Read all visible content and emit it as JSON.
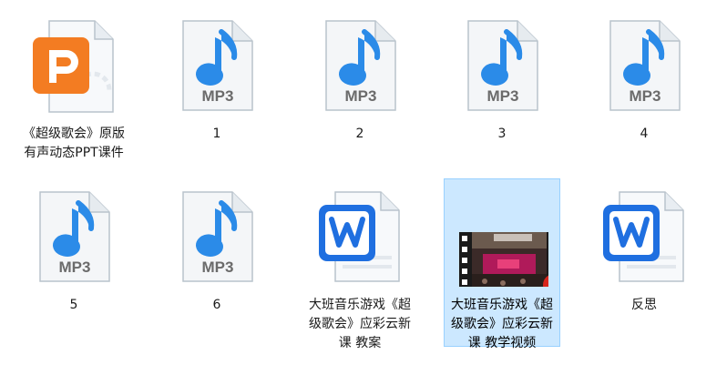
{
  "window": {
    "title": ""
  },
  "colors": {
    "accent": "#2b8be8",
    "ppt": "#f37c22",
    "wps": "#1f6fe0",
    "selection_bg": "#cce8ff",
    "selection_border": "#99d1ff"
  },
  "files": [
    {
      "name": "《超级歌会》原版有声动态PPT课件",
      "type": "ppt",
      "icon": "ppt-icon",
      "selected": false
    },
    {
      "name": "1",
      "type": "mp3",
      "icon": "mp3-icon",
      "badge": "MP3",
      "selected": false
    },
    {
      "name": "2",
      "type": "mp3",
      "icon": "mp3-icon",
      "badge": "MP3",
      "selected": false
    },
    {
      "name": "3",
      "type": "mp3",
      "icon": "mp3-icon",
      "badge": "MP3",
      "selected": false
    },
    {
      "name": "4",
      "type": "mp3",
      "icon": "mp3-icon",
      "badge": "MP3",
      "selected": false
    },
    {
      "name": "5",
      "type": "mp3",
      "icon": "mp3-icon",
      "badge": "MP3",
      "selected": false
    },
    {
      "name": "6",
      "type": "mp3",
      "icon": "mp3-icon",
      "badge": "MP3",
      "selected": false
    },
    {
      "name": "大班音乐游戏《超级歌会》应彩云新课 教案",
      "type": "doc",
      "icon": "wps-writer-icon",
      "selected": false
    },
    {
      "name": "大班音乐游戏《超级歌会》应彩云新课 教学视频",
      "type": "video",
      "icon": "video-thumbnail-icon",
      "selected": true
    },
    {
      "name": "反思",
      "type": "doc",
      "icon": "wps-writer-icon",
      "selected": false
    }
  ]
}
